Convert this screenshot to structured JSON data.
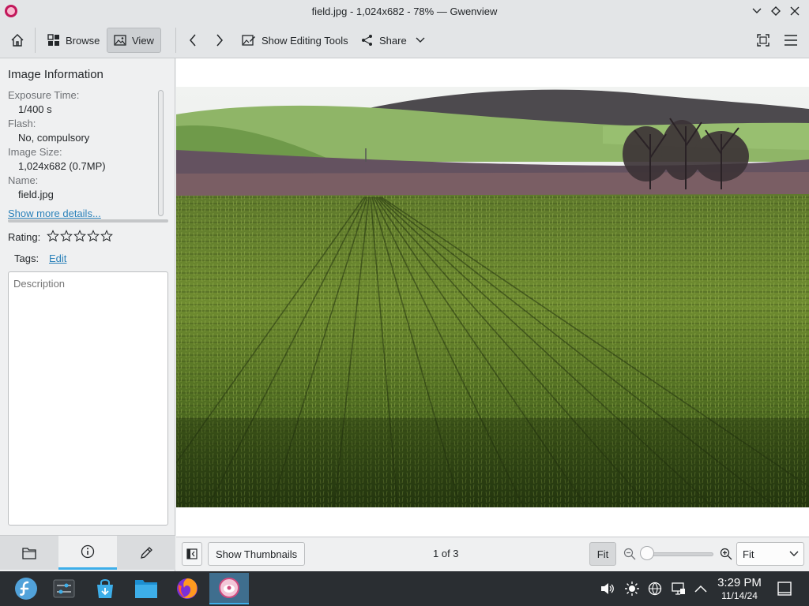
{
  "window": {
    "title": "field.jpg - 1,024x682 - 78% — Gwenview"
  },
  "toolbar": {
    "browse_label": "Browse",
    "view_label": "View",
    "editing_tools_label": "Show Editing Tools",
    "share_label": "Share"
  },
  "sidebar": {
    "heading": "Image Information",
    "meta": [
      {
        "key": "Exposure Time:",
        "value": "1/400 s"
      },
      {
        "key": "Flash:",
        "value": "No, compulsory"
      },
      {
        "key": "Image Size:",
        "value": "1,024x682 (0.7MP)"
      },
      {
        "key": "Name:",
        "value": "field.jpg"
      }
    ],
    "more_details_label": "Show more details...",
    "rating_label": "Rating:",
    "rating_value": 0,
    "rating_max": 5,
    "tags_label": "Tags:",
    "tags_edit_label": "Edit",
    "description_placeholder": "Description"
  },
  "bottombar": {
    "thumbnails_label": "Show Thumbnails",
    "position_label": "1 of 3",
    "fit_label": "Fit",
    "zoom_mode": "Fit"
  },
  "taskbar": {
    "time": "3:29 PM",
    "date": "11/14/24"
  },
  "colors": {
    "accent": "#3daee9",
    "link": "#2980b9",
    "taskbar": "#2a2e32"
  }
}
